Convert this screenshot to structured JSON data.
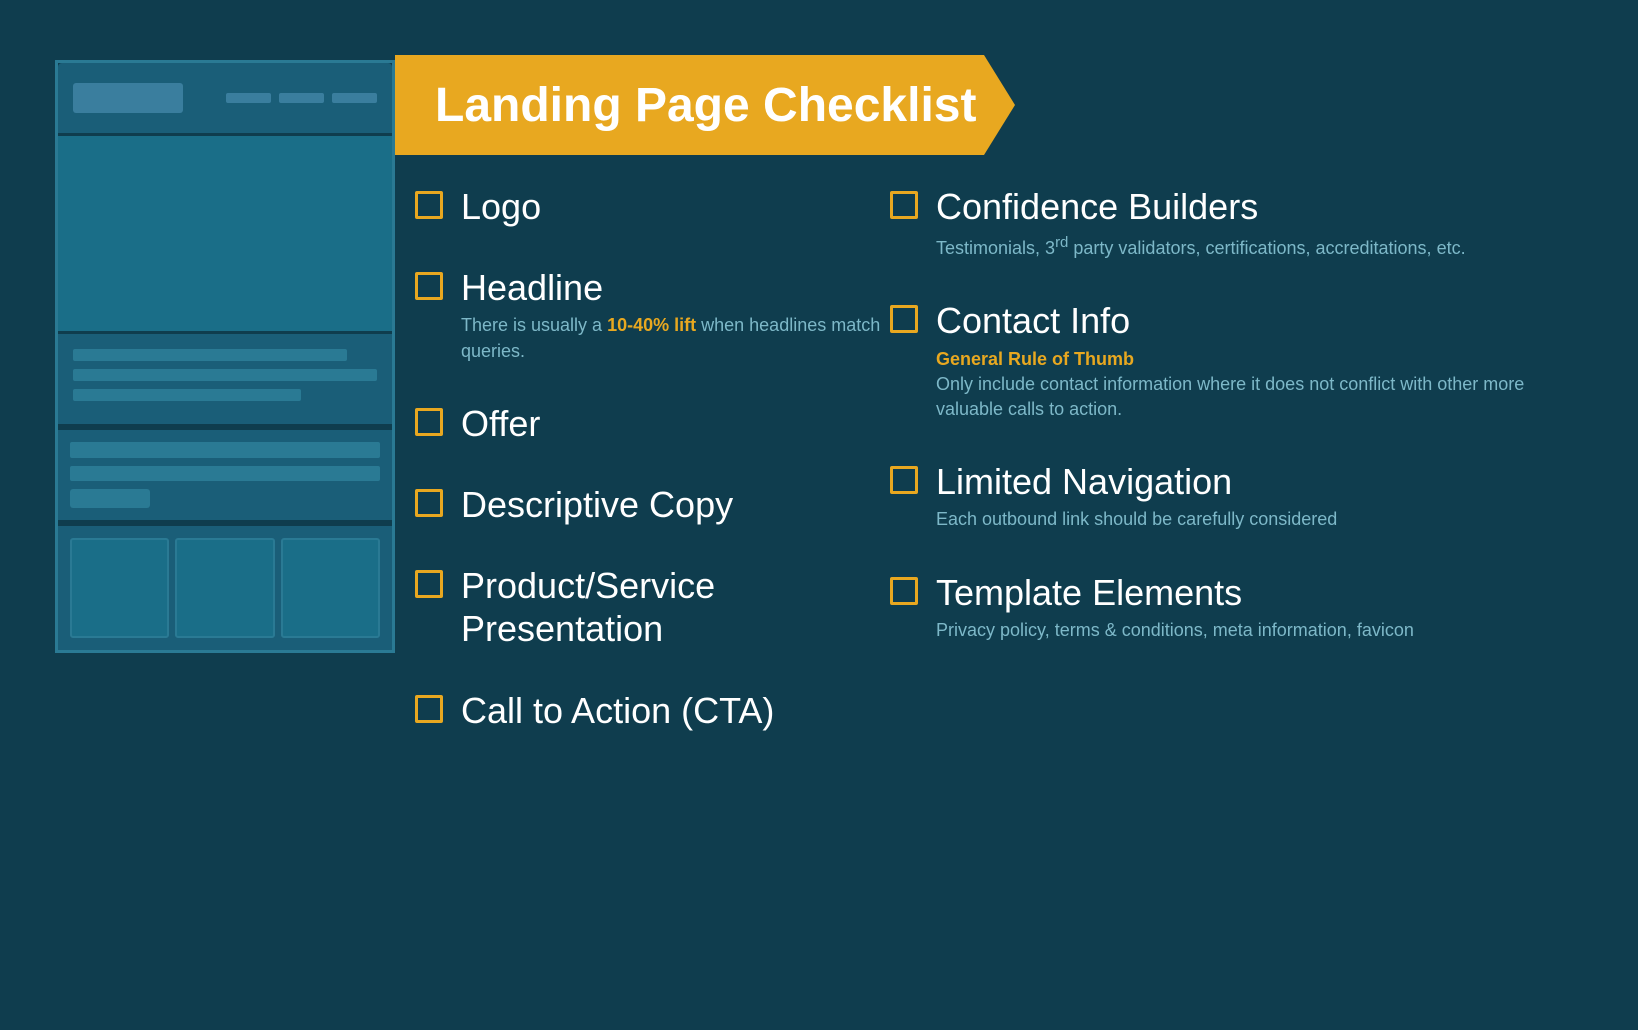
{
  "page": {
    "background_color": "#0f3d4e",
    "banner": {
      "title": "Landing Page Checklist"
    },
    "checklist_left": [
      {
        "id": "logo",
        "title": "Logo",
        "description": ""
      },
      {
        "id": "headline",
        "title": "Headline",
        "description": "There is usually a 10-40% lift when  headlines match queries."
      },
      {
        "id": "offer",
        "title": "Offer",
        "description": ""
      },
      {
        "id": "descriptive-copy",
        "title": "Descriptive Copy",
        "description": ""
      },
      {
        "id": "product-service",
        "title": "Product/Service Presentation",
        "description": ""
      },
      {
        "id": "cta",
        "title": "Call to Action (CTA)",
        "description": ""
      }
    ],
    "checklist_right": [
      {
        "id": "confidence-builders",
        "title": "Confidence Builders",
        "description": "Testimonials, 3rd party validators, certifications, accreditations, etc."
      },
      {
        "id": "contact-info",
        "title": "Contact Info",
        "rule_title": "General Rule of Thumb",
        "description": "Only include contact information where it does not conflict with other more valuable calls to action."
      },
      {
        "id": "limited-navigation",
        "title": "Limited Navigation",
        "description": "Each outbound link should be carefully considered"
      },
      {
        "id": "template-elements",
        "title": "Template Elements",
        "description": "Privacy policy, terms & conditions, meta information, favicon"
      }
    ]
  }
}
